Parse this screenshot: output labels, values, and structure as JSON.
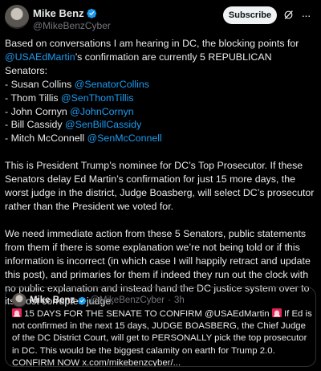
{
  "author": {
    "name": "Mike Benz",
    "handle": "@MikeBenzCyber"
  },
  "actions": {
    "subscribe_label": "Subscribe",
    "grok_icon": "grok-slash-icon",
    "more_icon": "more-icon"
  },
  "post": {
    "intro": "Based on conversations I am hearing in DC, the blocking points for",
    "intro_link": "@USAEdMartin",
    "intro_rest": "’s confirmation are currently 5 REPUBLICAN Senators:",
    "senators": [
      {
        "name": "- Susan Collins ",
        "handle": "@SenatorCollins"
      },
      {
        "name": "- Thom Tillis ",
        "handle": "@SenThomTillis"
      },
      {
        "name": "- John Cornyn ",
        "handle": "@JohnCornyn"
      },
      {
        "name": "- Bill Cassidy ",
        "handle": "@SenBillCassidy"
      },
      {
        "name": "- Mitch McConnell ",
        "handle": "@SenMcConnell"
      }
    ],
    "para2": "This is President Trump’s nominee for DC’s Top Prosecutor. If these Senators delay Ed Martin’s confirmation for just 15 more days, the worst judge in the district, Judge Boasberg, will select DC’s prosecutor rather than the President we voted for.",
    "para3": "We need immediate action from these 5 Senators, public statements from them if there is some explanation we’re not being told or if this information is incorrect (in which case I will happily retract and update this post), and primaries for them if indeed they run out the clock with no public explanation and instead hand the DC justice system over to its most corrupted judge."
  },
  "quote": {
    "name": "Mike Benz",
    "handle": "@MikeBenzCyber",
    "separator": "·",
    "time": "3h",
    "text_a": " 15 DAYS FOR THE SENATE TO CONFIRM @USAEdMartin ",
    "text_b": " If Ed is not confirmed in the next 15 days, JUDGE BOASBERG, the Chief Judge of the DC District Court, will get to PERSONALLY pick the top prosecutor in DC. This would be the biggest calamity on earth for Trump 2.0. CONFIRM NOW x.com/mikebenzcyber/..."
  },
  "colors": {
    "background": "#000000",
    "text": "#e7e9ea",
    "muted": "#71767b",
    "link": "#1d9bf0",
    "verified": "#1d9bf0",
    "border": "#2f3336"
  }
}
